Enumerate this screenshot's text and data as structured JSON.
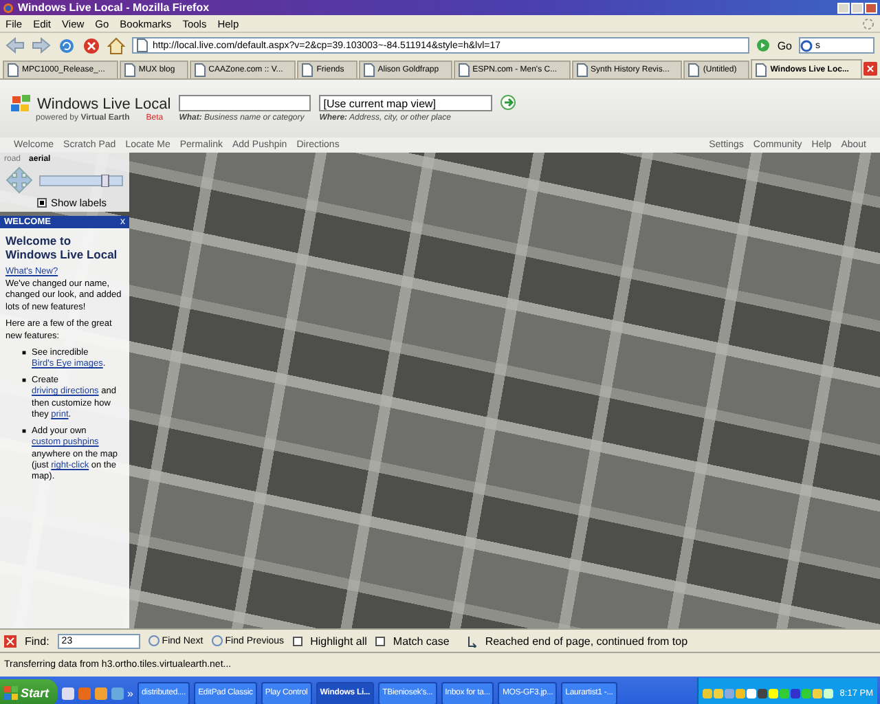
{
  "window": {
    "title": "Windows Live Local - Mozilla Firefox"
  },
  "menu": [
    "File",
    "Edit",
    "View",
    "Go",
    "Bookmarks",
    "Tools",
    "Help"
  ],
  "toolbar": {
    "url": "http://local.live.com/default.aspx?v=2&cp=39.103003~-84.511914&style=h&lvl=17",
    "go": "Go",
    "search_value": "s"
  },
  "tabs": [
    {
      "label": "MPC1000_Release_...",
      "selected": false
    },
    {
      "label": "MUX blog",
      "selected": false
    },
    {
      "label": "CAAZone.com :: V...",
      "selected": false
    },
    {
      "label": "Friends",
      "selected": false
    },
    {
      "label": "Alison Goldfrapp",
      "selected": false
    },
    {
      "label": "ESPN.com - Men's C...",
      "selected": false
    },
    {
      "label": "Synth History Revis...",
      "selected": false
    },
    {
      "label": "(Untitled)",
      "selected": false
    },
    {
      "label": "Windows Live Loc...",
      "selected": true
    }
  ],
  "page": {
    "logo": {
      "name": "Windows Live Local",
      "powered_by": "powered by **Virtual Earth**",
      "beta": "Beta"
    },
    "what": {
      "label": "**What:** Business name or category"
    },
    "where": {
      "value": "[Use current map view]",
      "label": "**Where:** Address, city, or other place"
    },
    "nav_left": [
      "Welcome",
      "Scratch Pad",
      "Locate Me",
      "Permalink",
      "Add Pushpin",
      "Directions"
    ],
    "nav_right": [
      "Settings",
      "Community",
      "Help",
      "About"
    ]
  },
  "map_controls": {
    "views": [
      {
        "label": "road",
        "selected": false
      },
      {
        "label": "aerial",
        "selected": true
      }
    ],
    "show_labels": {
      "label": "Show labels",
      "checked": true
    }
  },
  "welcome_panel": {
    "header": "WELCOME",
    "close": "x",
    "title": "Welcome to Windows Live Local",
    "link": "What's New?",
    "intro": "We've changed our name, changed our look, and added lots of new features!",
    "lead": "Here are a few of the great new features:",
    "features": [
      {
        "bullet": "■",
        "parts": [
          {
            "text": "See incredible "
          },
          {
            "text": "Bird's Eye images",
            "link": true
          },
          {
            "text": "."
          }
        ]
      },
      {
        "bullet": "■",
        "parts": [
          {
            "text": "Create "
          },
          {
            "text": "driving directions",
            "link": true
          },
          {
            "text": " and then customize how they "
          },
          {
            "text": "print",
            "link": true
          },
          {
            "text": "."
          }
        ]
      },
      {
        "bullet": "■",
        "parts": [
          {
            "text": "Add your own "
          },
          {
            "text": "custom pushpins",
            "link": true
          },
          {
            "text": " anywhere on the map (just "
          },
          {
            "text": "right-click",
            "link": true
          },
          {
            "text": " on the map)."
          }
        ]
      }
    ]
  },
  "find_bar": {
    "label": "Find:",
    "value": "23",
    "next": "Find Next",
    "previous": "Find Previous",
    "highlight_all": {
      "label": "Highlight all",
      "checked": false
    },
    "match_case": {
      "label": "Match case",
      "checked": false
    },
    "message": "Reached end of page, continued from top"
  },
  "status_bar": "Transferring data from h3.ortho.tiles.virtualearth.net...",
  "taskbar": {
    "start": "Start",
    "more": "»",
    "tasks": [
      {
        "label": "distributed....",
        "selected": false
      },
      {
        "label": "EditPad Classic",
        "selected": false
      },
      {
        "label": "Play Control",
        "selected": false
      },
      {
        "label": "Windows Li...",
        "selected": true
      },
      {
        "label": "TBieniosek's...",
        "selected": false
      },
      {
        "label": "Inbox for ta...",
        "selected": false
      },
      {
        "label": "MOS-GF3.jp...",
        "selected": false
      },
      {
        "label": "Laurartist1 -...",
        "selected": false
      }
    ],
    "clock": "8:17 PM"
  }
}
